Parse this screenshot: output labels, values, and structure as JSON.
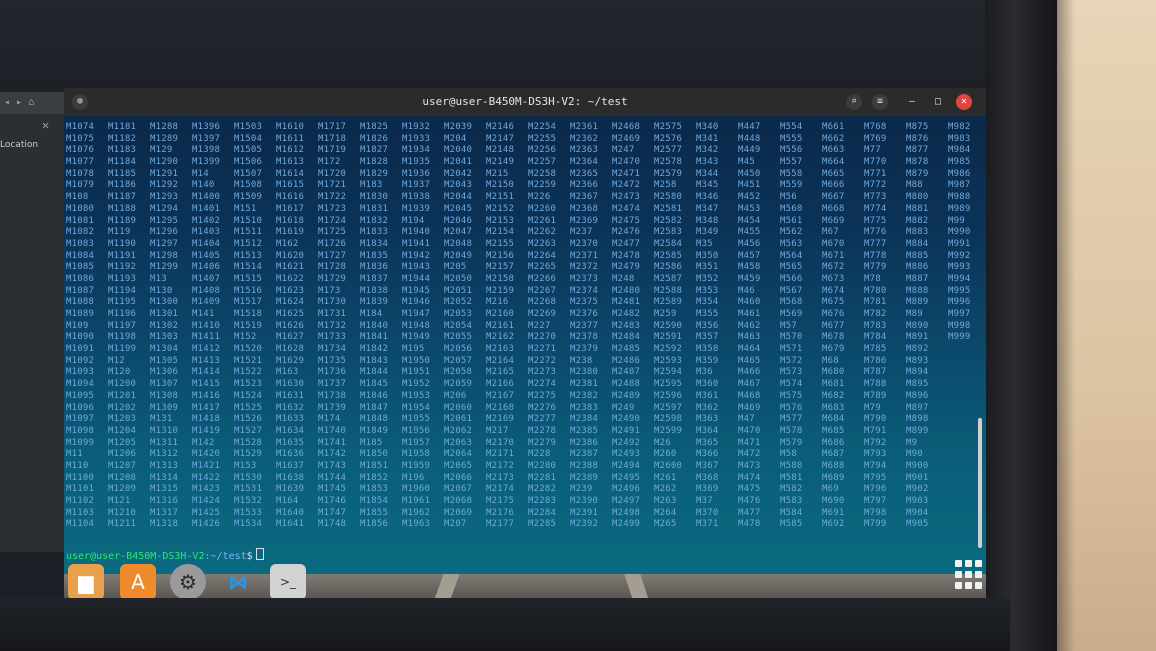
{
  "window": {
    "title": "user@user-B450M-DS3H-V2: ~/test"
  },
  "background_window": {
    "label": "Location"
  },
  "prompt": {
    "user_host": "user@user-B450M-DS3H-V2",
    "path": ":~/test",
    "symbol": "$"
  },
  "icons": {
    "title_search": "search-icon",
    "title_menu": "hamburger-menu-icon",
    "title_minimize": "minimize-icon",
    "title_maximize": "maximize-icon",
    "title_close": "close-icon",
    "dock": [
      "files-icon",
      "app-store-icon",
      "settings-icon",
      "vscode-icon",
      "terminal-icon"
    ],
    "show_apps": "show-applications-grid-icon"
  },
  "colors": {
    "output_text": "#6fa8dc",
    "prompt_user": "#2ee86d",
    "prompt_path": "#7fb4ff",
    "close_button": "#e2433d"
  },
  "terminal_output_columns": [
    [
      "M1074",
      "M1075",
      "M1076",
      "M1077",
      "M1078",
      "M1079",
      "M108",
      "M1080",
      "M1081",
      "M1082",
      "M1083",
      "M1084",
      "M1085",
      "M1086",
      "M1087",
      "M1088",
      "M1089",
      "M109",
      "M1090",
      "M1091",
      "M1092",
      "M1093",
      "M1094",
      "M1095",
      "M1096",
      "M1097",
      "M1098",
      "M1099",
      "M11",
      "M110",
      "M1100",
      "M1101",
      "M1102",
      "M1103",
      "M1104"
    ],
    [
      "M1181",
      "M1182",
      "M1183",
      "M1184",
      "M1185",
      "M1186",
      "M1187",
      "M1188",
      "M1189",
      "M119",
      "M1190",
      "M1191",
      "M1192",
      "M1193",
      "M1194",
      "M1195",
      "M1196",
      "M1197",
      "M1198",
      "M1199",
      "M12",
      "M120",
      "M1200",
      "M1201",
      "M1202",
      "M1203",
      "M1204",
      "M1205",
      "M1206",
      "M1207",
      "M1208",
      "M1209",
      "M121",
      "M1210",
      "M1211"
    ],
    [
      "M1288",
      "M1289",
      "M129",
      "M1290",
      "M1291",
      "M1292",
      "M1293",
      "M1294",
      "M1295",
      "M1296",
      "M1297",
      "M1298",
      "M1299",
      "M13",
      "M130",
      "M1300",
      "M1301",
      "M1302",
      "M1303",
      "M1304",
      "M1305",
      "M1306",
      "M1307",
      "M1308",
      "M1309",
      "M131",
      "M1310",
      "M1311",
      "M1312",
      "M1313",
      "M1314",
      "M1315",
      "M1316",
      "M1317",
      "M1318"
    ],
    [
      "M1396",
      "M1397",
      "M1398",
      "M1399",
      "M14",
      "M140",
      "M1400",
      "M1401",
      "M1402",
      "M1403",
      "M1404",
      "M1405",
      "M1406",
      "M1407",
      "M1408",
      "M1409",
      "M141",
      "M1410",
      "M1411",
      "M1412",
      "M1413",
      "M1414",
      "M1415",
      "M1416",
      "M1417",
      "M1418",
      "M1419",
      "M142",
      "M1420",
      "M1421",
      "M1422",
      "M1423",
      "M1424",
      "M1425",
      "M1426"
    ],
    [
      "M1503",
      "M1504",
      "M1505",
      "M1506",
      "M1507",
      "M1508",
      "M1509",
      "M151",
      "M1510",
      "M1511",
      "M1512",
      "M1513",
      "M1514",
      "M1515",
      "M1516",
      "M1517",
      "M1518",
      "M1519",
      "M152",
      "M1520",
      "M1521",
      "M1522",
      "M1523",
      "M1524",
      "M1525",
      "M1526",
      "M1527",
      "M1528",
      "M1529",
      "M153",
      "M1530",
      "M1531",
      "M1532",
      "M1533",
      "M1534"
    ],
    [
      "M1610",
      "M1611",
      "M1612",
      "M1613",
      "M1614",
      "M1615",
      "M1616",
      "M1617",
      "M1618",
      "M1619",
      "M162",
      "M1620",
      "M1621",
      "M1622",
      "M1623",
      "M1624",
      "M1625",
      "M1626",
      "M1627",
      "M1628",
      "M1629",
      "M163",
      "M1630",
      "M1631",
      "M1632",
      "M1633",
      "M1634",
      "M1635",
      "M1636",
      "M1637",
      "M1638",
      "M1639",
      "M164",
      "M1640",
      "M1641"
    ],
    [
      "M1717",
      "M1718",
      "M1719",
      "M172",
      "M1720",
      "M1721",
      "M1722",
      "M1723",
      "M1724",
      "M1725",
      "M1726",
      "M1727",
      "M1728",
      "M1729",
      "M173",
      "M1730",
      "M1731",
      "M1732",
      "M1733",
      "M1734",
      "M1735",
      "M1736",
      "M1737",
      "M1738",
      "M1739",
      "M174",
      "M1740",
      "M1741",
      "M1742",
      "M1743",
      "M1744",
      "M1745",
      "M1746",
      "M1747",
      "M1748"
    ],
    [
      "M1825",
      "M1826",
      "M1827",
      "M1828",
      "M1829",
      "M183",
      "M1830",
      "M1831",
      "M1832",
      "M1833",
      "M1834",
      "M1835",
      "M1836",
      "M1837",
      "M1838",
      "M1839",
      "M184",
      "M1840",
      "M1841",
      "M1842",
      "M1843",
      "M1844",
      "M1845",
      "M1846",
      "M1847",
      "M1848",
      "M1849",
      "M185",
      "M1850",
      "M1851",
      "M1852",
      "M1853",
      "M1854",
      "M1855",
      "M1856"
    ],
    [
      "M1932",
      "M1933",
      "M1934",
      "M1935",
      "M1936",
      "M1937",
      "M1938",
      "M1939",
      "M194",
      "M1940",
      "M1941",
      "M1942",
      "M1943",
      "M1944",
      "M1945",
      "M1946",
      "M1947",
      "M1948",
      "M1949",
      "M195",
      "M1950",
      "M1951",
      "M1952",
      "M1953",
      "M1954",
      "M1955",
      "M1956",
      "M1957",
      "M1958",
      "M1959",
      "M196",
      "M1960",
      "M1961",
      "M1962",
      "M1963"
    ],
    [
      "M2039",
      "M204",
      "M2040",
      "M2041",
      "M2042",
      "M2043",
      "M2044",
      "M2045",
      "M2046",
      "M2047",
      "M2048",
      "M2049",
      "M205",
      "M2050",
      "M2051",
      "M2052",
      "M2053",
      "M2054",
      "M2055",
      "M2056",
      "M2057",
      "M2058",
      "M2059",
      "M206",
      "M2060",
      "M2061",
      "M2062",
      "M2063",
      "M2064",
      "M2065",
      "M2066",
      "M2067",
      "M2068",
      "M2069",
      "M207"
    ],
    [
      "M2146",
      "M2147",
      "M2148",
      "M2149",
      "M215",
      "M2150",
      "M2151",
      "M2152",
      "M2153",
      "M2154",
      "M2155",
      "M2156",
      "M2157",
      "M2158",
      "M2159",
      "M216",
      "M2160",
      "M2161",
      "M2162",
      "M2163",
      "M2164",
      "M2165",
      "M2166",
      "M2167",
      "M2168",
      "M2169",
      "M217",
      "M2170",
      "M2171",
      "M2172",
      "M2173",
      "M2174",
      "M2175",
      "M2176",
      "M2177"
    ],
    [
      "M2254",
      "M2255",
      "M2256",
      "M2257",
      "M2258",
      "M2259",
      "M226",
      "M2260",
      "M2261",
      "M2262",
      "M2263",
      "M2264",
      "M2265",
      "M2266",
      "M2267",
      "M2268",
      "M2269",
      "M227",
      "M2270",
      "M2271",
      "M2272",
      "M2273",
      "M2274",
      "M2275",
      "M2276",
      "M2277",
      "M2278",
      "M2279",
      "M228",
      "M2280",
      "M2281",
      "M2282",
      "M2283",
      "M2284",
      "M2285"
    ],
    [
      "M2361",
      "M2362",
      "M2363",
      "M2364",
      "M2365",
      "M2366",
      "M2367",
      "M2368",
      "M2369",
      "M237",
      "M2370",
      "M2371",
      "M2372",
      "M2373",
      "M2374",
      "M2375",
      "M2376",
      "M2377",
      "M2378",
      "M2379",
      "M238",
      "M2380",
      "M2381",
      "M2382",
      "M2383",
      "M2384",
      "M2385",
      "M2386",
      "M2387",
      "M2388",
      "M2389",
      "M239",
      "M2390",
      "M2391",
      "M2392"
    ],
    [
      "M2468",
      "M2469",
      "M247",
      "M2470",
      "M2471",
      "M2472",
      "M2473",
      "M2474",
      "M2475",
      "M2476",
      "M2477",
      "M2478",
      "M2479",
      "M248",
      "M2480",
      "M2481",
      "M2482",
      "M2483",
      "M2484",
      "M2485",
      "M2486",
      "M2487",
      "M2488",
      "M2489",
      "M249",
      "M2490",
      "M2491",
      "M2492",
      "M2493",
      "M2494",
      "M2495",
      "M2496",
      "M2497",
      "M2498",
      "M2499"
    ],
    [
      "M2575",
      "M2576",
      "M2577",
      "M2578",
      "M2579",
      "M258",
      "M2580",
      "M2581",
      "M2582",
      "M2583",
      "M2584",
      "M2585",
      "M2586",
      "M2587",
      "M2588",
      "M2589",
      "M259",
      "M2590",
      "M2591",
      "M2592",
      "M2593",
      "M2594",
      "M2595",
      "M2596",
      "M2597",
      "M2598",
      "M2599",
      "M26",
      "M260",
      "M2600",
      "M261",
      "M262",
      "M263",
      "M264",
      "M265"
    ],
    [
      "M340",
      "M341",
      "M342",
      "M343",
      "M344",
      "M345",
      "M346",
      "M347",
      "M348",
      "M349",
      "M35",
      "M350",
      "M351",
      "M352",
      "M353",
      "M354",
      "M355",
      "M356",
      "M357",
      "M358",
      "M359",
      "M36",
      "M360",
      "M361",
      "M362",
      "M363",
      "M364",
      "M365",
      "M366",
      "M367",
      "M368",
      "M369",
      "M37",
      "M370",
      "M371"
    ],
    [
      "M447",
      "M448",
      "M449",
      "M45",
      "M450",
      "M451",
      "M452",
      "M453",
      "M454",
      "M455",
      "M456",
      "M457",
      "M458",
      "M459",
      "M46",
      "M460",
      "M461",
      "M462",
      "M463",
      "M464",
      "M465",
      "M466",
      "M467",
      "M468",
      "M469",
      "M47",
      "M470",
      "M471",
      "M472",
      "M473",
      "M474",
      "M475",
      "M476",
      "M477",
      "M478"
    ],
    [
      "M554",
      "M555",
      "M556",
      "M557",
      "M558",
      "M559",
      "M56",
      "M560",
      "M561",
      "M562",
      "M563",
      "M564",
      "M565",
      "M566",
      "M567",
      "M568",
      "M569",
      "M57",
      "M570",
      "M571",
      "M572",
      "M573",
      "M574",
      "M575",
      "M576",
      "M577",
      "M578",
      "M579",
      "M58",
      "M580",
      "M581",
      "M582",
      "M583",
      "M584",
      "M585"
    ],
    [
      "M661",
      "M662",
      "M663",
      "M664",
      "M665",
      "M666",
      "M667",
      "M668",
      "M669",
      "M67",
      "M670",
      "M671",
      "M672",
      "M673",
      "M674",
      "M675",
      "M676",
      "M677",
      "M678",
      "M679",
      "M68",
      "M680",
      "M681",
      "M682",
      "M683",
      "M684",
      "M685",
      "M686",
      "M687",
      "M688",
      "M689",
      "M69",
      "M690",
      "M691",
      "M692"
    ],
    [
      "M768",
      "M769",
      "M77",
      "M770",
      "M771",
      "M772",
      "M773",
      "M774",
      "M775",
      "M776",
      "M777",
      "M778",
      "M779",
      "M78",
      "M780",
      "M781",
      "M782",
      "M783",
      "M784",
      "M785",
      "M786",
      "M787",
      "M788",
      "M789",
      "M79",
      "M790",
      "M791",
      "M792",
      "M793",
      "M794",
      "M795",
      "M796",
      "M797",
      "M798",
      "M799"
    ],
    [
      "M875",
      "M876",
      "M877",
      "M878",
      "M879",
      "M88",
      "M880",
      "M881",
      "M882",
      "M883",
      "M884",
      "M885",
      "M886",
      "M887",
      "M888",
      "M889",
      "M89",
      "M890",
      "M891",
      "M892",
      "M893",
      "M894",
      "M895",
      "M896",
      "M897",
      "M898",
      "M899",
      "M9",
      "M90",
      "M900",
      "M901",
      "M902",
      "M903",
      "M904",
      "M905"
    ],
    [
      "M982",
      "M983",
      "M984",
      "M985",
      "M986",
      "M987",
      "M988",
      "M989",
      "M99",
      "M990",
      "M991",
      "M992",
      "M993",
      "M994",
      "M995",
      "M996",
      "M997",
      "M998",
      "M999"
    ]
  ]
}
